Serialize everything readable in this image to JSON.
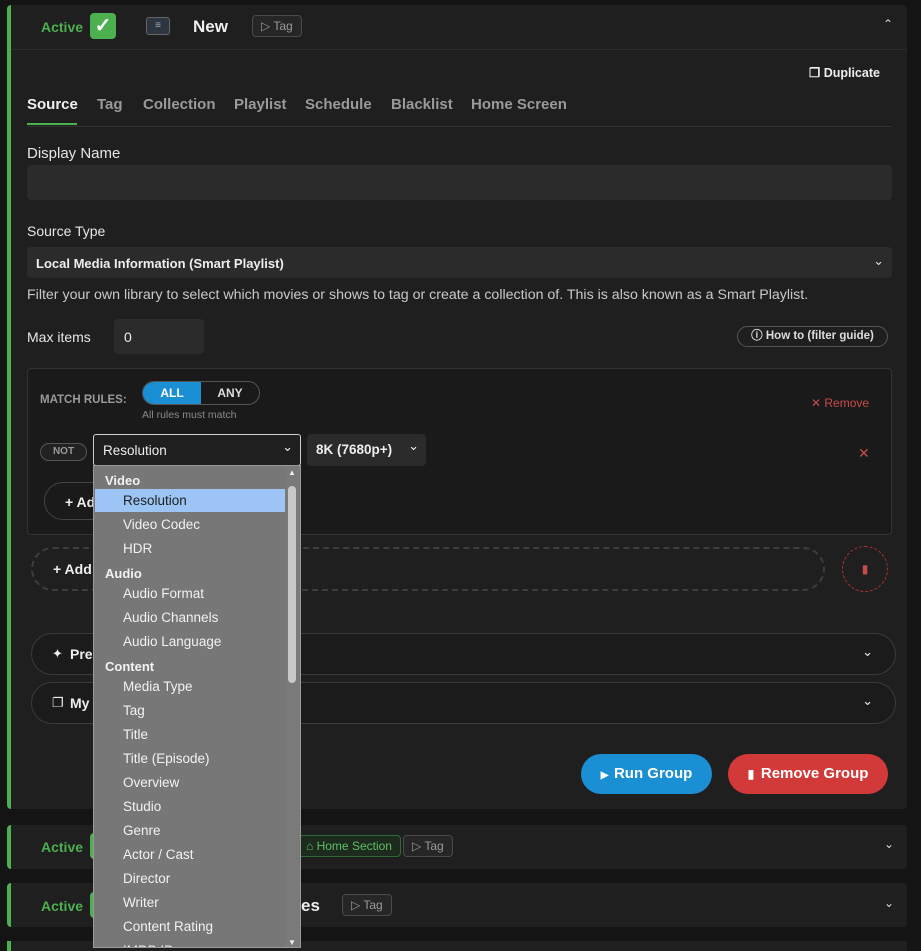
{
  "group1": {
    "active_label": "Active",
    "name": "New",
    "tag_label": "Tag",
    "duplicate_label": "Duplicate",
    "tabs": [
      {
        "label": "Source"
      },
      {
        "label": "Tag"
      },
      {
        "label": "Collection"
      },
      {
        "label": "Playlist"
      },
      {
        "label": "Schedule"
      },
      {
        "label": "Blacklist"
      },
      {
        "label": "Home Screen"
      }
    ],
    "display_name_label": "Display Name",
    "display_name_value": "",
    "source_type_label": "Source Type",
    "source_type_value": "Local Media Information (Smart Playlist)",
    "source_help": "Filter your own library to select which movies or shows to tag or create a collection of. This is also known as a Smart Playlist.",
    "max_items_label": "Max items",
    "max_items_value": "0",
    "filter_guide_label": "How to (filter guide)",
    "match_rules_label": "MATCH RULES:",
    "match_all": "ALL",
    "match_any": "ANY",
    "match_hint": "All rules must match",
    "remove_label": "Remove",
    "not_label": "NOT",
    "rule_field_value": "Resolution",
    "rule_value": "8K (7680p+)",
    "add_rule_partial": "+ Ad",
    "add_group_partial": "+ Add",
    "preview_partial": "Pre",
    "my_partial": "My",
    "run_group_label": "Run Group",
    "remove_group_label": "Remove Group"
  },
  "dropdown": {
    "groups": [
      {
        "label": "Video",
        "options": [
          "Resolution",
          "Video Codec",
          "HDR"
        ]
      },
      {
        "label": "Audio",
        "options": [
          "Audio Format",
          "Audio Channels",
          "Audio Language"
        ]
      },
      {
        "label": "Content",
        "options": [
          "Media Type",
          "Tag",
          "Title",
          "Title (Episode)",
          "Overview",
          "Studio",
          "Genre",
          "Actor / Cast",
          "Director",
          "Writer",
          "Content Rating",
          "IMDB ID"
        ]
      }
    ],
    "selected": "Resolution"
  },
  "group2": {
    "active_label": "Active",
    "home_section_label": "Home Section",
    "tag_label": "Tag"
  },
  "group3": {
    "active_label": "Active",
    "name_partial": "es",
    "tag_label": "Tag"
  },
  "colors": {
    "accent_green": "#4caf50",
    "run_blue": "#1a8fd4",
    "remove_red": "#d23a3a"
  }
}
